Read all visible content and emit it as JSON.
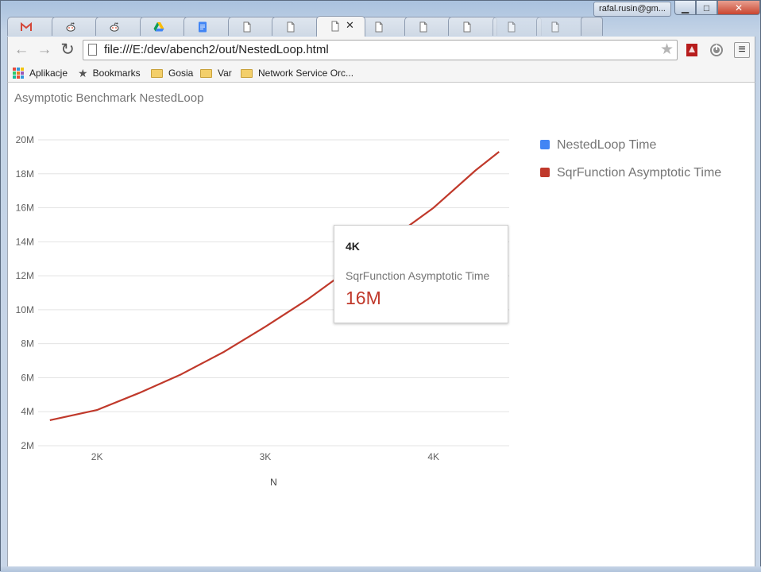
{
  "window": {
    "profile_label": "rafal.rusin@gm...",
    "controls": {
      "minimize": "▁",
      "maximize": "□",
      "close": "✕"
    }
  },
  "tabs": [
    {
      "icon": "gmail-icon",
      "label": "M",
      "color": "#d44638"
    },
    {
      "icon": "reddit-icon"
    },
    {
      "icon": "reddit-icon"
    },
    {
      "icon": "drive-icon"
    },
    {
      "icon": "docs-icon",
      "color": "#4285f4"
    },
    {
      "icon": "page-icon"
    },
    {
      "icon": "page-icon"
    },
    {
      "icon": "page-icon",
      "active": true,
      "close": "✕"
    },
    {
      "icon": "page-icon"
    },
    {
      "icon": "page-icon"
    },
    {
      "icon": "page-icon"
    },
    {
      "icon": "page-icon"
    },
    {
      "icon": "page-icon"
    }
  ],
  "toolbar": {
    "back": "←",
    "forward": "→",
    "reload": "↻",
    "url": "file:///E:/dev/abench2/out/NestedLoop.html",
    "star": "★",
    "menu": "≡"
  },
  "bookmarks": {
    "apps_label": "Aplikacje",
    "items": [
      "Bookmarks",
      "Gosia",
      "Var",
      "Network Service Orc..."
    ]
  },
  "page": {
    "title": "Asymptotic Benchmark NestedLoop"
  },
  "chart_data": {
    "type": "line",
    "title": "Asymptotic Benchmark NestedLoop",
    "xlabel": "N",
    "ylabel": "",
    "xlim": [
      1650,
      4450
    ],
    "ylim": [
      2000000,
      20000000
    ],
    "x_ticks": [
      {
        "value": 2000,
        "label": "2K"
      },
      {
        "value": 3000,
        "label": "3K"
      },
      {
        "value": 4000,
        "label": "4K"
      }
    ],
    "y_ticks": [
      {
        "value": 2000000,
        "label": "2M"
      },
      {
        "value": 4000000,
        "label": "4M"
      },
      {
        "value": 6000000,
        "label": "6M"
      },
      {
        "value": 8000000,
        "label": "8M"
      },
      {
        "value": 10000000,
        "label": "10M"
      },
      {
        "value": 12000000,
        "label": "12M"
      },
      {
        "value": 14000000,
        "label": "14M"
      },
      {
        "value": 16000000,
        "label": "16M"
      },
      {
        "value": 18000000,
        "label": "18M"
      },
      {
        "value": 20000000,
        "label": "20M"
      }
    ],
    "grid": true,
    "legend_position": "right",
    "series": [
      {
        "name": "NestedLoop Time",
        "color": "#4285f4",
        "x": [],
        "y": []
      },
      {
        "name": "SqrFunction Asymptotic Time",
        "color": "#c0392b",
        "x": [
          1720,
          2000,
          2250,
          2500,
          2750,
          3000,
          3250,
          3500,
          3750,
          4000,
          4250,
          4390
        ],
        "y": [
          3500000,
          4100000,
          5100000,
          6200000,
          7500000,
          9000000,
          10600000,
          12400000,
          14200000,
          16000000,
          18200000,
          19300000
        ]
      }
    ],
    "tooltip": {
      "header": "4K",
      "series": "SqrFunction Asymptotic Time",
      "value": "16M",
      "color": "#c0392b"
    }
  }
}
